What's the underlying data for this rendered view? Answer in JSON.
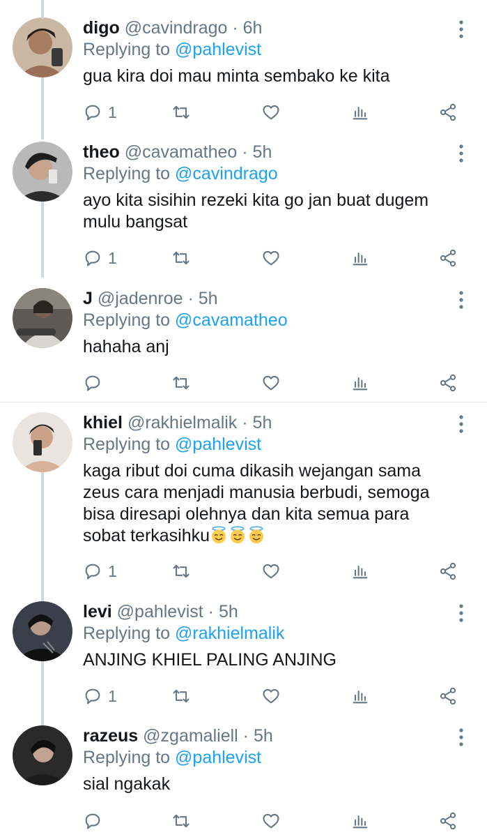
{
  "tweets": [
    {
      "name": "digo",
      "handle": "@cavindrago",
      "time": "6h",
      "reply_prefix": "Replying to",
      "reply_to": "@pahlevist",
      "text": "gua kira doi mau minta sembako ke kita",
      "reply_count": "1"
    },
    {
      "name": "theo",
      "handle": "@cavamatheo",
      "time": "5h",
      "reply_prefix": "Replying to",
      "reply_to": "@cavindrago",
      "text": "ayo kita sisihin rezeki kita go jan buat dugem mulu bangsat",
      "reply_count": "1"
    },
    {
      "name": "J",
      "handle": "@jadenroe",
      "time": "5h",
      "reply_prefix": "Replying to",
      "reply_to": "@cavamatheo",
      "text": "hahaha anj",
      "reply_count": ""
    },
    {
      "name": "khiel",
      "handle": "@rakhielmalik",
      "time": "5h",
      "reply_prefix": "Replying to",
      "reply_to": "@pahlevist",
      "text": "kaga ribut doi cuma dikasih wejangan sama zeus cara menjadi manusia berbudi, semoga bisa diresapi olehnya dan kita semua para sobat terkasihku",
      "emoji": [
        "smiling-face-with-halo",
        "smiling-face-with-halo",
        "smiling-face-with-halo"
      ],
      "reply_count": "1"
    },
    {
      "name": "levi",
      "handle": "@pahlevist",
      "time": "5h",
      "reply_prefix": "Replying to",
      "reply_to": "@rakhielmalik",
      "text": "ANJING KHIEL PALING ANJING",
      "reply_count": "1"
    },
    {
      "name": "razeus",
      "handle": "@zgamaliell",
      "time": "5h",
      "reply_prefix": "Replying to",
      "reply_to": "@pahlevist",
      "text": "sial ngakak",
      "reply_count": ""
    }
  ],
  "separator": "·",
  "icons": {
    "reply": "reply-icon",
    "retweet": "retweet-icon",
    "like": "like-icon",
    "analytics": "analytics-icon",
    "share": "share-icon",
    "more": "more-vertical-icon"
  },
  "colors": {
    "text": "#14171a",
    "secondary": "#657786",
    "link": "#1da1f2",
    "divider": "#e1e8ed",
    "thread": "#cfd9de"
  }
}
